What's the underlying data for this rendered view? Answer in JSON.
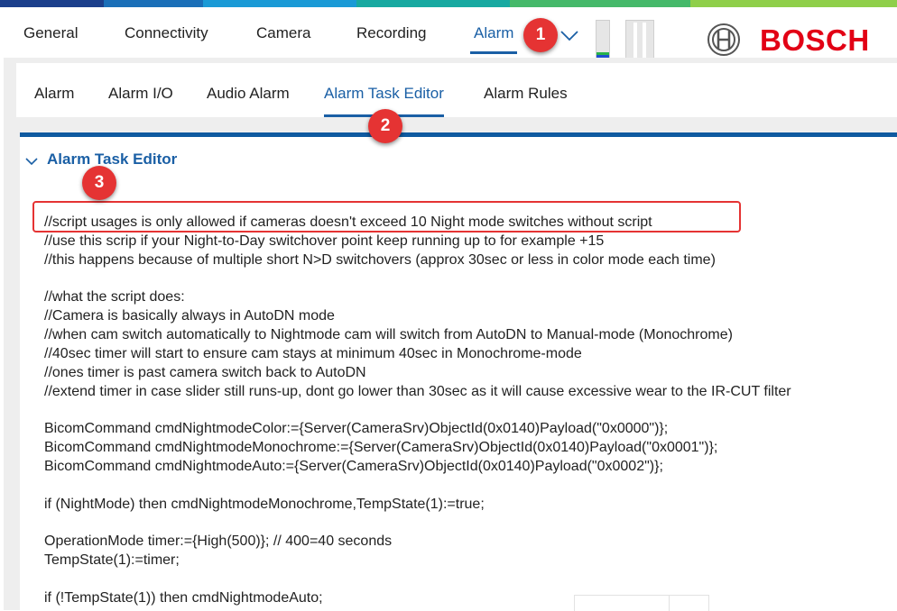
{
  "colors": {
    "stripe": [
      "#1b3f8b",
      "#1a6fb8",
      "#1a9ad6",
      "#18a9a1",
      "#45b96a",
      "#8fcf4a"
    ],
    "accent": "#1a5fa5",
    "brand": "#e20015",
    "annotation": "#e53333"
  },
  "main_nav": {
    "tabs": [
      {
        "label": "General"
      },
      {
        "label": "Connectivity"
      },
      {
        "label": "Camera"
      },
      {
        "label": "Recording"
      },
      {
        "label": "Alarm",
        "active": true
      }
    ],
    "expand_icon": "chevron-down-icon",
    "level_meter": "audio-level-meter",
    "brand": "BOSCH"
  },
  "sub_nav": {
    "tabs": [
      {
        "label": "Alarm"
      },
      {
        "label": "Alarm I/O"
      },
      {
        "label": "Audio Alarm"
      },
      {
        "label": "Alarm Task Editor",
        "active": true
      },
      {
        "label": "Alarm Rules"
      }
    ]
  },
  "editor": {
    "title": "Alarm Task Editor",
    "collapse_icon": "chevron-down-icon",
    "lines": [
      "//script usages is only allowed if cameras doesn't exceed 10 Night mode switches without script",
      "//use this scrip if your Night-to-Day switchover point keep running up to for example +15",
      "//this happens because of multiple short N>D switchovers (approx 30sec or less in color mode each time)",
      "",
      "//what the script does:",
      "//Camera is basically always in AutoDN mode",
      "//when cam switch automatically to Nightmode cam will switch from AutoDN to Manual-mode (Monochrome)",
      "//40sec timer will start to ensure cam stays at minimum 40sec in Monochrome-mode",
      "//ones timer is past camera switch back to AutoDN",
      "//extend timer in case slider still runs-up, dont go lower than 30sec as it will cause excessive wear to the IR-CUT filter",
      "",
      "BicomCommand cmdNightmodeColor:={Server(CameraSrv)ObjectId(0x0140)Payload(\"0x0000\")};",
      "BicomCommand cmdNightmodeMonochrome:={Server(CameraSrv)ObjectId(0x0140)Payload(\"0x0001\")};",
      "BicomCommand cmdNightmodeAuto:={Server(CameraSrv)ObjectId(0x0140)Payload(\"0x0002\")};",
      "",
      "if (NightMode) then cmdNightmodeMonochrome,TempState(1):=true;",
      "",
      "OperationMode timer:={High(500)}; // 400=40 seconds",
      "TempState(1):=timer;",
      "",
      "if (!TempState(1)) then cmdNightmodeAuto;"
    ]
  },
  "annotations": {
    "badge1": "1",
    "badge2": "2",
    "badge3": "3"
  }
}
